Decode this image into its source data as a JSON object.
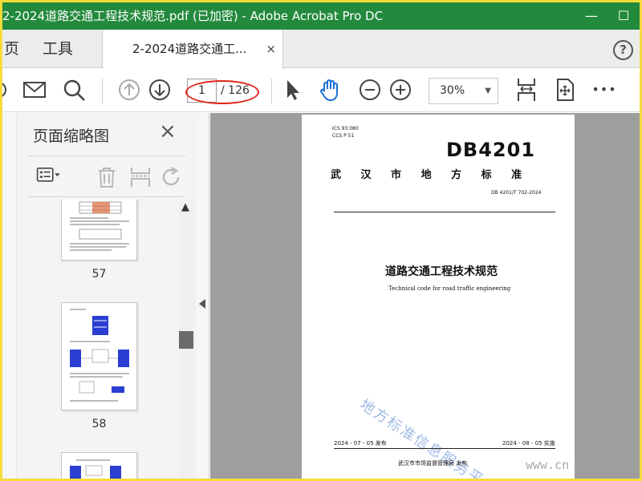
{
  "window": {
    "title": "2-2024道路交通工程技术规范.pdf  (已加密)  - Adobe Acrobat Pro DC",
    "minimize": "—",
    "maximize": "☐"
  },
  "tabs": {
    "home": "页",
    "tools": "工具",
    "document": "2-2024道路交通工...",
    "close": "×",
    "help": "?"
  },
  "toolbar": {
    "current_page": "1",
    "total_pages": "/ 126",
    "zoom": "30%",
    "more": "•••"
  },
  "sidebar": {
    "title": "页面缩略图",
    "close": "×",
    "thumbnails": [
      {
        "page": "57"
      },
      {
        "page": "58"
      }
    ]
  },
  "document": {
    "ics": "ICS  93.080",
    "ccs": "CCS  P 51",
    "code": "DB4201",
    "region": "武 汉 市 地 方 标 准",
    "standard_no": "DB 4201/T  702-2024",
    "title_cn": "道路交通工程技术规范",
    "title_en": "Technical code for road traffic engineering",
    "watermark": "地方标准信息服务平台",
    "issue_date": "2024 - 07 - 05 发布",
    "impl_date": "2024 - 08 - 05 实施",
    "issuer": "武汉市市场监督管理局     发布"
  },
  "overlay": {
    "site": "www.cn"
  },
  "colors": {
    "titlebar": "#238a3d",
    "highlight_border": "#f5dc3a",
    "annotation": "#e0261b",
    "hand_tool": "#1a6fd6"
  }
}
